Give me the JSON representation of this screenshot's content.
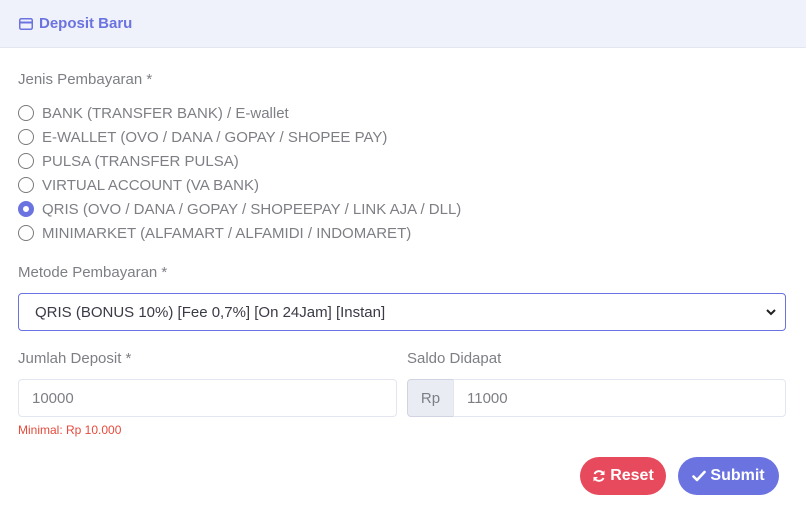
{
  "header": {
    "title": "Deposit Baru",
    "icon": "card-icon"
  },
  "payment_type": {
    "label": "Jenis Pembayaran *",
    "options": [
      {
        "label": "BANK (TRANSFER BANK) / E-wallet",
        "checked": false
      },
      {
        "label": "E-WALLET (OVO / DANA / GOPAY / SHOPEE PAY)",
        "checked": false
      },
      {
        "label": "PULSA (TRANSFER PULSA)",
        "checked": false
      },
      {
        "label": "VIRTUAL ACCOUNT (VA BANK)",
        "checked": false
      },
      {
        "label": "QRIS (OVO / DANA / GOPAY / SHOPEEPAY / LINK AJA / DLL)",
        "checked": true
      },
      {
        "label": "MINIMARKET (ALFAMART / ALFAMIDI / INDOMARET)",
        "checked": false
      }
    ]
  },
  "payment_method": {
    "label": "Metode Pembayaran *",
    "selected": "QRIS (BONUS 10%) [Fee 0,7%] [On 24Jam] [Instan]"
  },
  "deposit_amount": {
    "label": "Jumlah Deposit *",
    "value": "10000",
    "hint": "Minimal: Rp 10.000"
  },
  "balance_received": {
    "label": "Saldo Didapat",
    "prefix": "Rp",
    "value": "11000"
  },
  "buttons": {
    "reset": "Reset",
    "submit": "Submit"
  },
  "colors": {
    "accent": "#6b73e0",
    "danger": "#e74a5c",
    "header_bg": "#f0f2fb"
  }
}
